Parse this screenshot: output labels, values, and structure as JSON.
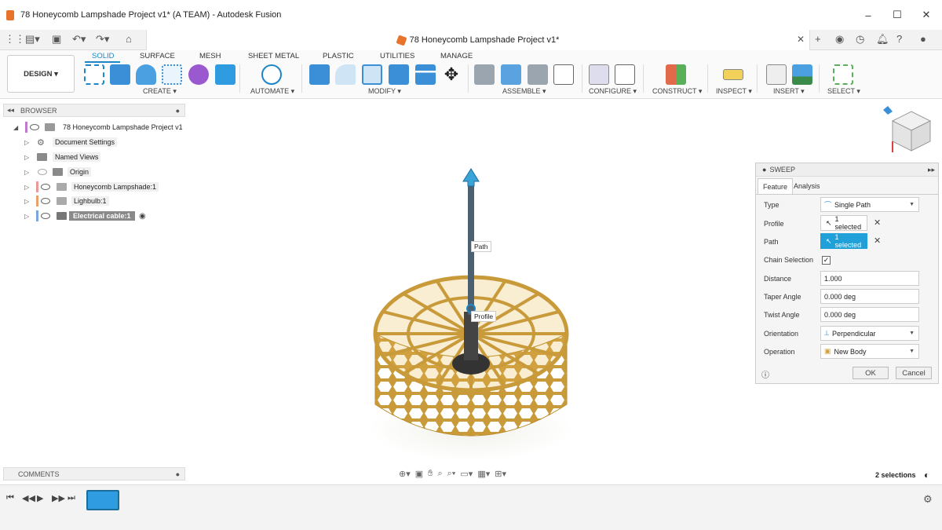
{
  "window": {
    "title": "78 Honeycomb Lampshade Project v1* (A TEAM) - Autodesk Fusion",
    "minimize": "–",
    "maximize": "☐",
    "close": "✕"
  },
  "document_tab": {
    "title": "78 Honeycomb Lampshade Project v1*",
    "close": "✕"
  },
  "ribbon": {
    "workspace": "DESIGN ▾",
    "tabs": [
      "SOLID",
      "SURFACE",
      "MESH",
      "SHEET METAL",
      "PLASTIC",
      "UTILITIES",
      "MANAGE"
    ],
    "groups": [
      "CREATE ▾",
      "AUTOMATE ▾",
      "MODIFY ▾",
      "ASSEMBLE ▾",
      "CONFIGURE ▾",
      "CONSTRUCT ▾",
      "INSPECT ▾",
      "INSERT ▾",
      "SELECT ▾"
    ]
  },
  "browser": {
    "header": "BROWSER",
    "items": [
      {
        "label": "78 Honeycomb Lampshade Project v1"
      },
      {
        "label": "Document Settings"
      },
      {
        "label": "Named Views"
      },
      {
        "label": "Origin"
      },
      {
        "label": "Honeycomb Lampshade:1"
      },
      {
        "label": "Lighbulb:1"
      },
      {
        "label": "Electrical cable:1"
      }
    ]
  },
  "comments": {
    "header": "COMMENTS"
  },
  "viewport": {
    "path_label": "Path",
    "profile_label": "Profile"
  },
  "sweep": {
    "title": "SWEEP",
    "tabs": [
      "Feature",
      "Analysis"
    ],
    "type_label": "Type",
    "type_value": "Single Path",
    "profile_label": "Profile",
    "profile_value": "1 selected",
    "path_label": "Path",
    "path_value": "1 selected",
    "chain_label": "Chain Selection",
    "chain_checked": "✓",
    "distance_label": "Distance",
    "distance_value": "1.000",
    "taper_label": "Taper Angle",
    "taper_value": "0.000 deg",
    "twist_label": "Twist Angle",
    "twist_value": "0.000 deg",
    "orientation_label": "Orientation",
    "orientation_value": "Perpendicular",
    "operation_label": "Operation",
    "operation_value": "New Body",
    "ok": "OK",
    "cancel": "Cancel"
  },
  "status": {
    "selections": "2 selections"
  },
  "colors": {
    "accent": "#1c86c8",
    "active_field": "#1fa0d8",
    "lamp": "#d4a23c"
  }
}
